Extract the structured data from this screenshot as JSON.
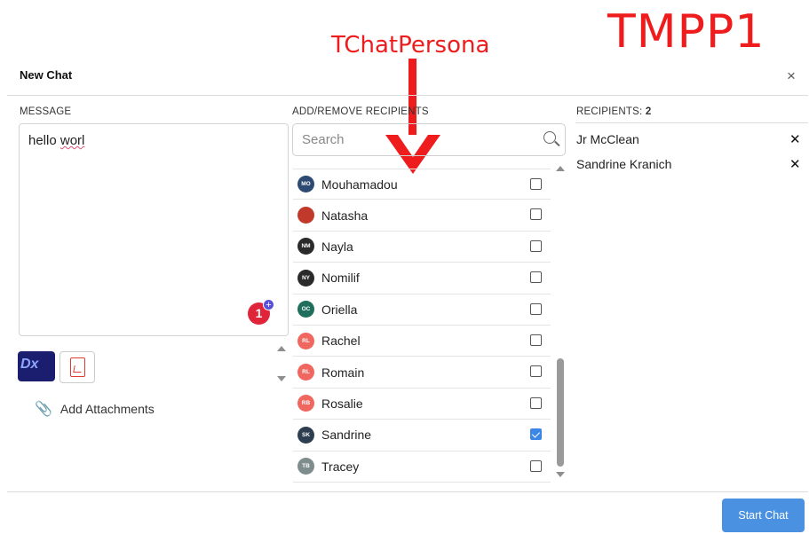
{
  "annotations": {
    "top_right": "TMPP1",
    "arrow_label": "TChatPersona"
  },
  "dialog": {
    "title": "New Chat",
    "close_glyph": "×"
  },
  "message": {
    "label": "MESSAGE",
    "text_correct": "hello ",
    "text_misspelled": "worl",
    "badge_count": "1",
    "badge_plus": "+"
  },
  "attachments": {
    "thumb1_text": "Dx",
    "add_label": "Add Attachments"
  },
  "recipients_picker": {
    "label": "ADD/REMOVE RECIPIENTS",
    "search_placeholder": "Search",
    "items": [
      {
        "initials": "MO",
        "name": "Mouhamadou",
        "color": "#2d4a73",
        "checked": false
      },
      {
        "initials": "",
        "name": "Natasha",
        "color": "#c0392b",
        "checked": false
      },
      {
        "initials": "NM",
        "name": "Nayla",
        "color": "#2a2a2a",
        "checked": false
      },
      {
        "initials": "NY",
        "name": "Nomilif",
        "color": "#2a2a2a",
        "checked": false
      },
      {
        "initials": "OC",
        "name": "Oriella",
        "color": "#1f6f5c",
        "checked": false
      },
      {
        "initials": "RL",
        "name": "Rachel",
        "color": "#f0675f",
        "checked": false
      },
      {
        "initials": "RL",
        "name": "Romain",
        "color": "#f0675f",
        "checked": false
      },
      {
        "initials": "RB",
        "name": "Rosalie",
        "color": "#f0675f",
        "checked": false
      },
      {
        "initials": "SK",
        "name": "Sandrine",
        "color": "#2c3e50",
        "checked": true
      },
      {
        "initials": "TB",
        "name": "Tracey",
        "color": "#7f8c8d",
        "checked": false
      }
    ]
  },
  "recipients": {
    "label": "RECIPIENTS:",
    "count": "2",
    "list": [
      {
        "name": "Jr McClean",
        "remove": "✕"
      },
      {
        "name": "Sandrine Kranich",
        "remove": "✕"
      }
    ]
  },
  "footer": {
    "start_label": "Start Chat"
  },
  "colors": {
    "accent": "#4a91e2",
    "annotation_red": "#ee1c1c",
    "badge_red": "#e0243a"
  }
}
